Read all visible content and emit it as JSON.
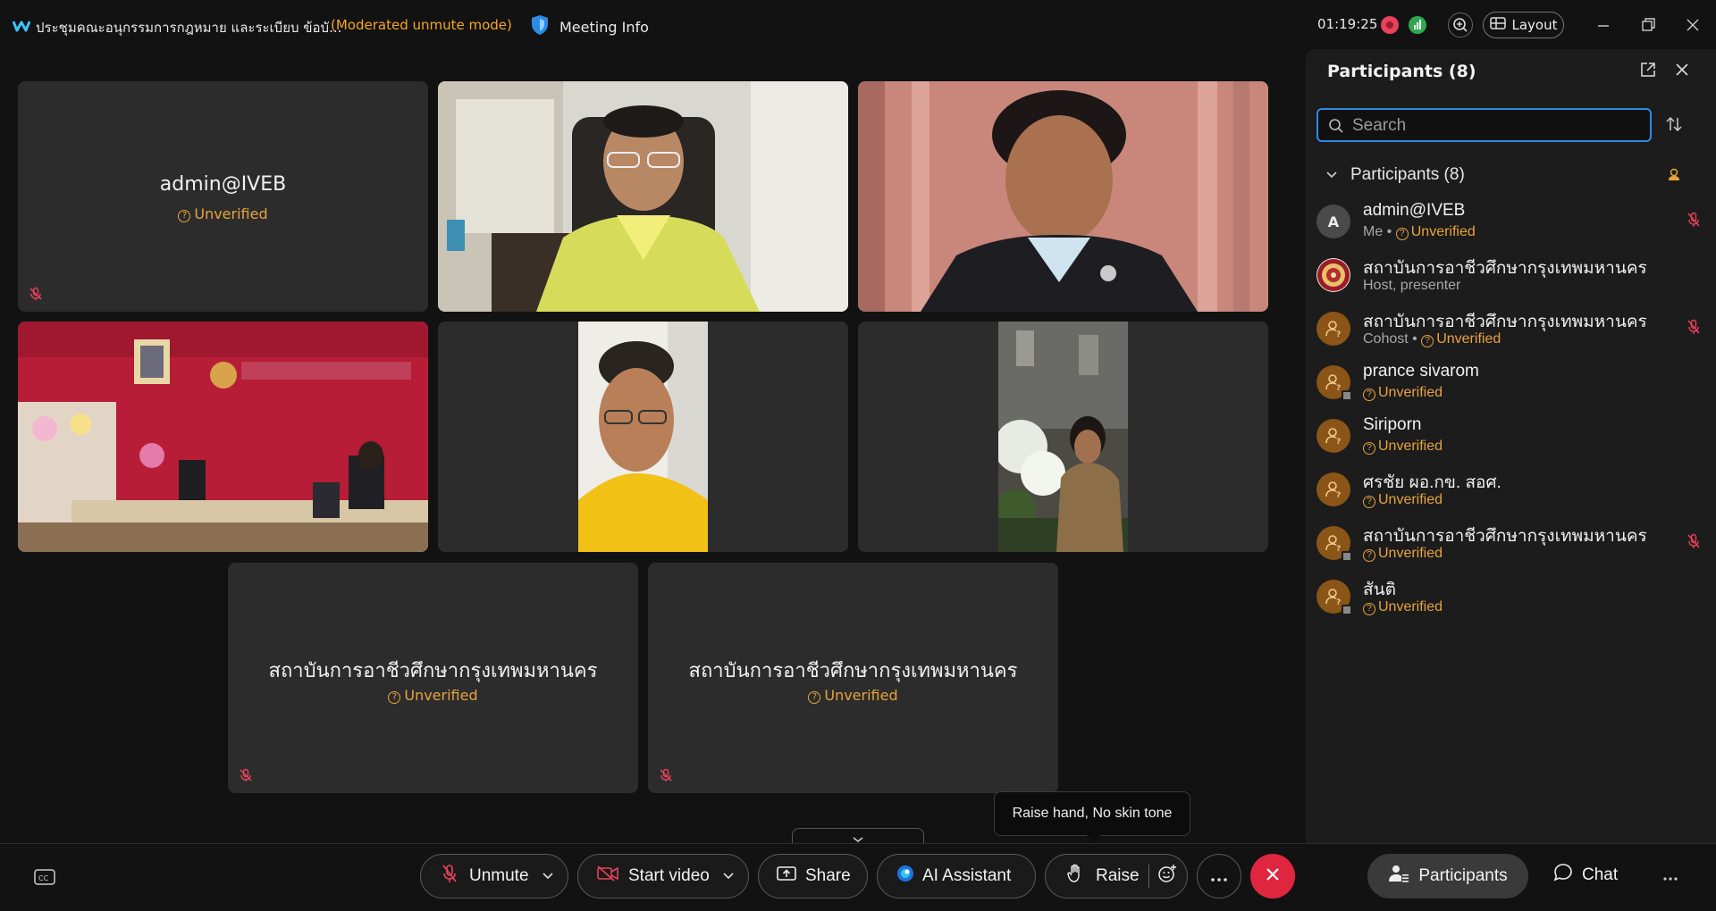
{
  "titlebar": {
    "title": "ประชุมคณะอนุกรรมการกฎหมาย และระเบียบ ข้อบั...",
    "mode": "(Moderated unmute mode)",
    "meeting_info": "Meeting Info",
    "time": "01:19:25",
    "layout_label": "Layout"
  },
  "tiles": {
    "admin_name": "admin@IVEB",
    "admin_status": "Unverified",
    "inst1_name": "สถาบันการอาชีวศึกษากรุงเทพมหานคร",
    "inst1_status": "Unverified",
    "inst2_name": "สถาบันการอาชีวศึกษากรุงเทพมหานคร",
    "inst2_status": "Unverified"
  },
  "panel": {
    "title": "Participants (8)",
    "search_placeholder": "Search",
    "section_label": "Participants (8)",
    "participants": [
      {
        "initial": "A",
        "name": "admin@IVEB",
        "role": "Me",
        "status": "Unverified"
      },
      {
        "name": "สถาบันการอาชีวศึกษากรุงเทพมหานคร",
        "role": "Host, presenter"
      },
      {
        "name": "สถาบันการอาชีวศึกษากรุงเทพมหานคร",
        "role": "Cohost",
        "status": "Unverified"
      },
      {
        "name": "prance sivarom",
        "status": "Unverified"
      },
      {
        "name": "Siriporn",
        "status": "Unverified"
      },
      {
        "name": "ศรชัย ผอ.กข. สอศ.",
        "status": "Unverified"
      },
      {
        "name": "สถาบันการอาชีวศึกษากรุงเทพมหานคร",
        "status": "Unverified"
      },
      {
        "name": "สันติ",
        "status": "Unverified"
      }
    ]
  },
  "controls": {
    "unmute": "Unmute",
    "start_video": "Start video",
    "share": "Share",
    "ai_assistant": "AI Assistant",
    "raise": "Raise",
    "tooltip": "Raise hand, No skin tone",
    "participants": "Participants",
    "chat": "Chat"
  },
  "colors": {
    "accent_blue": "#2b8be6",
    "unverified": "#e8a33d",
    "end_call": "#e0263f",
    "mute_red": "#e8425c"
  }
}
